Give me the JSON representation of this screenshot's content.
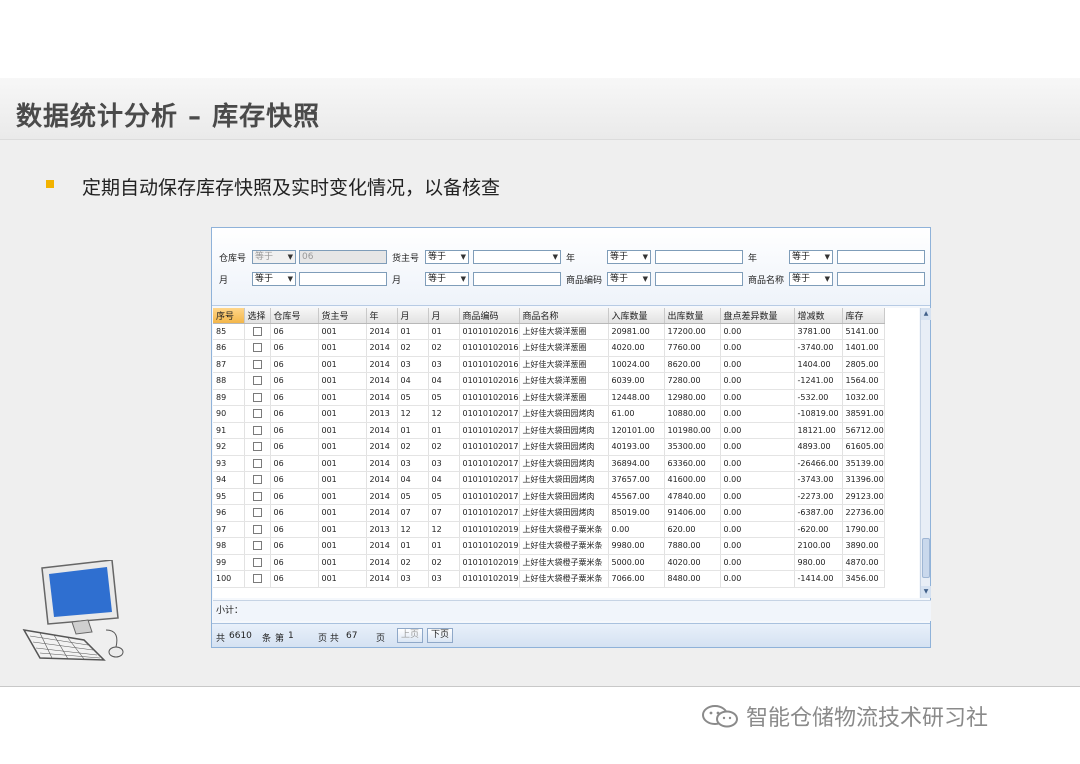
{
  "slide": {
    "title": "数据统计分析 – 库存快照",
    "bullet": "定期自动保存库存快照及实时变化情况，以备核查",
    "footer": "智能仓储物流技术研习社",
    "accent": "#f2b200"
  },
  "filters": {
    "warehouse_label": "仓库号",
    "warehouse_op": "等于",
    "warehouse_value": "06",
    "owner_label": "货主号",
    "owner_op": "等于",
    "year1_label": "年",
    "year1_op": "等于",
    "year2_label": "年",
    "year2_op": "等于",
    "month1_label": "月",
    "month1_op": "等于",
    "month2_label": "月",
    "month2_op": "等于",
    "code_label": "商品编码",
    "code_op": "等于",
    "name_label": "商品名称",
    "name_op": "等于"
  },
  "table": {
    "columns": [
      "序号",
      "选择",
      "仓库号",
      "货主号",
      "年",
      "月",
      "月",
      "商品编码",
      "商品名称",
      "入库数量",
      "出库数量",
      "盘点差异数量",
      "增减数",
      "库存"
    ],
    "rows": [
      [
        "85",
        "06",
        "001",
        "2014",
        "01",
        "01",
        "01010102016",
        "上好佳大袋洋葱圈",
        "20981.00",
        "17200.00",
        "0.00",
        "3781.00",
        "5141.00"
      ],
      [
        "86",
        "06",
        "001",
        "2014",
        "02",
        "02",
        "01010102016",
        "上好佳大袋洋葱圈",
        "4020.00",
        "7760.00",
        "0.00",
        "-3740.00",
        "1401.00"
      ],
      [
        "87",
        "06",
        "001",
        "2014",
        "03",
        "03",
        "01010102016",
        "上好佳大袋洋葱圈",
        "10024.00",
        "8620.00",
        "0.00",
        "1404.00",
        "2805.00"
      ],
      [
        "88",
        "06",
        "001",
        "2014",
        "04",
        "04",
        "01010102016",
        "上好佳大袋洋葱圈",
        "6039.00",
        "7280.00",
        "0.00",
        "-1241.00",
        "1564.00"
      ],
      [
        "89",
        "06",
        "001",
        "2014",
        "05",
        "05",
        "01010102016",
        "上好佳大袋洋葱圈",
        "12448.00",
        "12980.00",
        "0.00",
        "-532.00",
        "1032.00"
      ],
      [
        "90",
        "06",
        "001",
        "2013",
        "12",
        "12",
        "01010102017",
        "上好佳大袋田园烤肉",
        "61.00",
        "10880.00",
        "0.00",
        "-10819.00",
        "38591.00"
      ],
      [
        "91",
        "06",
        "001",
        "2014",
        "01",
        "01",
        "01010102017",
        "上好佳大袋田园烤肉",
        "120101.00",
        "101980.00",
        "0.00",
        "18121.00",
        "56712.00"
      ],
      [
        "92",
        "06",
        "001",
        "2014",
        "02",
        "02",
        "01010102017",
        "上好佳大袋田园烤肉",
        "40193.00",
        "35300.00",
        "0.00",
        "4893.00",
        "61605.00"
      ],
      [
        "93",
        "06",
        "001",
        "2014",
        "03",
        "03",
        "01010102017",
        "上好佳大袋田园烤肉",
        "36894.00",
        "63360.00",
        "0.00",
        "-26466.00",
        "35139.00"
      ],
      [
        "94",
        "06",
        "001",
        "2014",
        "04",
        "04",
        "01010102017",
        "上好佳大袋田园烤肉",
        "37657.00",
        "41600.00",
        "0.00",
        "-3743.00",
        "31396.00"
      ],
      [
        "95",
        "06",
        "001",
        "2014",
        "05",
        "05",
        "01010102017",
        "上好佳大袋田园烤肉",
        "45567.00",
        "47840.00",
        "0.00",
        "-2273.00",
        "29123.00"
      ],
      [
        "96",
        "06",
        "001",
        "2014",
        "07",
        "07",
        "01010102017",
        "上好佳大袋田园烤肉",
        "85019.00",
        "91406.00",
        "0.00",
        "-6387.00",
        "22736.00"
      ],
      [
        "97",
        "06",
        "001",
        "2013",
        "12",
        "12",
        "01010102019",
        "上好佳大袋橙子粟米条",
        "0.00",
        "620.00",
        "0.00",
        "-620.00",
        "1790.00"
      ],
      [
        "98",
        "06",
        "001",
        "2014",
        "01",
        "01",
        "01010102019",
        "上好佳大袋橙子粟米条",
        "9980.00",
        "7880.00",
        "0.00",
        "2100.00",
        "3890.00"
      ],
      [
        "99",
        "06",
        "001",
        "2014",
        "02",
        "02",
        "01010102019",
        "上好佳大袋橙子粟米条",
        "5000.00",
        "4020.00",
        "0.00",
        "980.00",
        "4870.00"
      ],
      [
        "100",
        "06",
        "001",
        "2014",
        "03",
        "03",
        "01010102019",
        "上好佳大袋橙子粟米条",
        "7066.00",
        "8480.00",
        "0.00",
        "-1414.00",
        "3456.00"
      ]
    ]
  },
  "summary": {
    "label": "小计："
  },
  "pager": {
    "total_prefix": "共",
    "total": "6610",
    "total_unit": "条",
    "page_prefix": "第",
    "page": "1",
    "pages_prefix": "页 共",
    "pages": "67",
    "pages_unit": "页",
    "prev": "上页",
    "next": "下页"
  }
}
